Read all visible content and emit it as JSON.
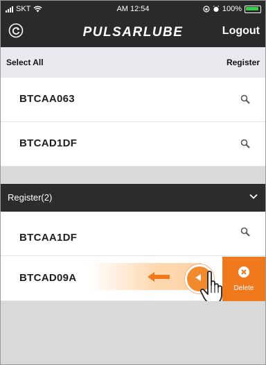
{
  "status_bar": {
    "carrier": "SKT",
    "time": "AM 12:54",
    "battery": "100%"
  },
  "app_bar": {
    "logo": "PULSARLUBE",
    "logout_label": "Logout"
  },
  "select_bar": {
    "select_all": "Select All",
    "register": "Register"
  },
  "unregistered": [
    {
      "id": "BTCAA063"
    },
    {
      "id": "BTCAD1DF"
    }
  ],
  "registered_section": {
    "title": "Register(2)"
  },
  "registered": [
    {
      "id": "BTCAA1DF"
    },
    {
      "id": "BTCAD09A"
    }
  ],
  "swipe_action": {
    "delete_label": "Delete"
  },
  "colors": {
    "header_bg": "#2a2a2a",
    "accent_orange": "#f0791e",
    "battery_green": "#36d14a"
  },
  "icons": [
    "wifi-icon",
    "signal-icon",
    "alarm-icon",
    "battery-icon",
    "refresh-icon",
    "search-icon",
    "chevron-down-icon",
    "swipe-left-arrow-icon",
    "delete-icon",
    "hand-pointer-icon"
  ]
}
